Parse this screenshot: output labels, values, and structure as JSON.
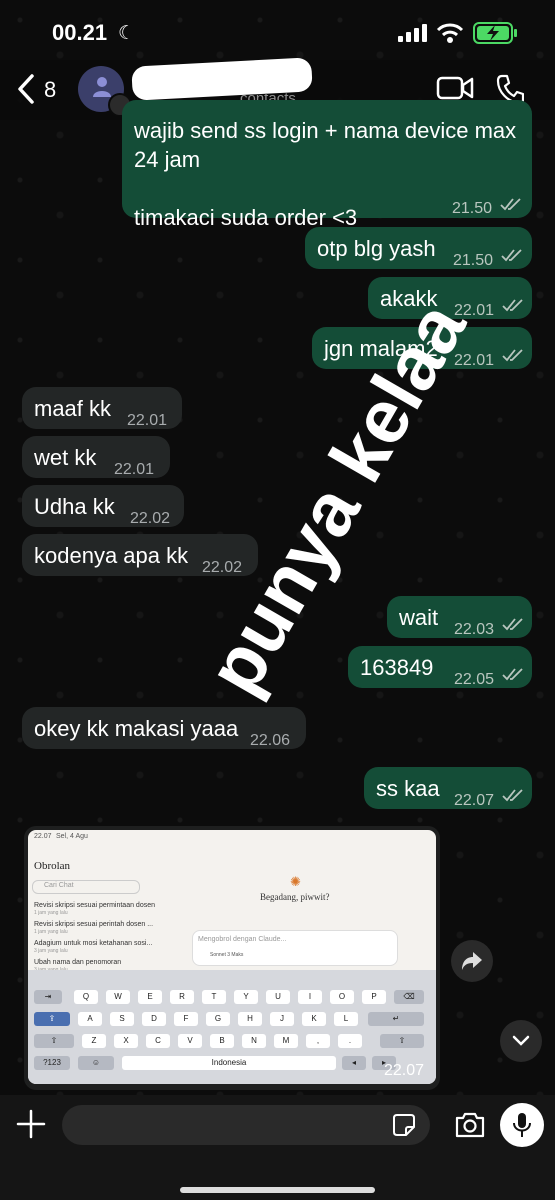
{
  "status_bar": {
    "time": "00.21"
  },
  "header": {
    "back_count": "8",
    "subtitle": "contacts"
  },
  "messages": [
    {
      "dir": "out",
      "text": "wajib send ss login + nama device max\n24 jam\n\ntimakaci suda order <3",
      "time": "21.50"
    },
    {
      "dir": "out",
      "text": "otp blg yash",
      "time": "21.50"
    },
    {
      "dir": "out",
      "text": "akakk",
      "time": "22.01"
    },
    {
      "dir": "out",
      "text": "jgn malam2",
      "time": "22.01"
    },
    {
      "dir": "in",
      "text": "maaf kk",
      "time": "22.01"
    },
    {
      "dir": "in",
      "text": "wet kk",
      "time": "22.01"
    },
    {
      "dir": "in",
      "text": "Udha kk",
      "time": "22.02"
    },
    {
      "dir": "in",
      "text": "kodenya apa kk",
      "time": "22.02"
    },
    {
      "dir": "out",
      "text": "wait",
      "time": "22.03"
    },
    {
      "dir": "out",
      "text": "163849",
      "time": "22.05"
    },
    {
      "dir": "in",
      "text": "okey kk makasi yaaa",
      "time": "22.06"
    },
    {
      "dir": "out",
      "text": "ss kaa",
      "time": "22.07"
    }
  ],
  "watermark": "punya kelaa",
  "image_message": {
    "time": "22.07",
    "screenshot": {
      "status_time": "22.07",
      "status_date": "Sel, 4 Agu",
      "sidebar_title": "Obrolan",
      "search_placeholder": "Cari Chat",
      "chats": [
        {
          "title": "Revisi skripsi sesuai permintaan dosen",
          "time": "1 jam yang lalu"
        },
        {
          "title": "Revisi skripsi sesuai perintah dosen ...",
          "time": "1 jam yang lalu"
        },
        {
          "title": "Adagium untuk mosi ketahanan sosi...",
          "time": "3 jam yang lalu"
        },
        {
          "title": "Ubah nama dan penomoran",
          "time": "3 jam yang lalu"
        }
      ],
      "greeting": "Begadang, piwwit?",
      "input_placeholder": "Mengobrol dengan Claude...",
      "model": "Sonnet 3 Maks",
      "keyboard_rows": [
        [
          "Q",
          "W",
          "E",
          "R",
          "T",
          "Y",
          "U",
          "I",
          "O",
          "P"
        ],
        [
          "A",
          "S",
          "D",
          "F",
          "G",
          "H",
          "J",
          "K",
          "L"
        ],
        [
          "Z",
          "X",
          "C",
          "V",
          "B",
          "N",
          "M",
          ",",
          "."
        ]
      ],
      "space_label": "Indonesia",
      "num_key": "?123"
    }
  }
}
